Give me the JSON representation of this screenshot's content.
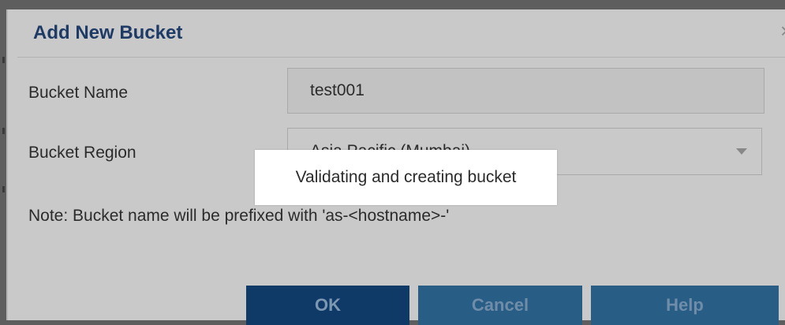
{
  "dialog": {
    "title": "Add New Bucket",
    "close_glyph": "×",
    "close_icon": "close-icon"
  },
  "form": {
    "bucket_name_label": "Bucket Name",
    "bucket_name_value": "test001",
    "bucket_region_label": "Bucket Region",
    "bucket_region_value": "Asia Pacific (Mumbai)",
    "region_dropdown_icon": "chevron-down-icon",
    "note": "Note: Bucket name will be prefixed with 'as-<hostname>-'"
  },
  "buttons": {
    "ok": "OK",
    "cancel": "Cancel",
    "help": "Help"
  },
  "loading": {
    "message": "Validating and creating bucket"
  },
  "colors": {
    "title": "#1e3b66",
    "ok_button": "#0f3a68",
    "secondary_button": "#285d86",
    "overlay_background": "#c9c9c9",
    "popup_background": "#ffffff"
  }
}
